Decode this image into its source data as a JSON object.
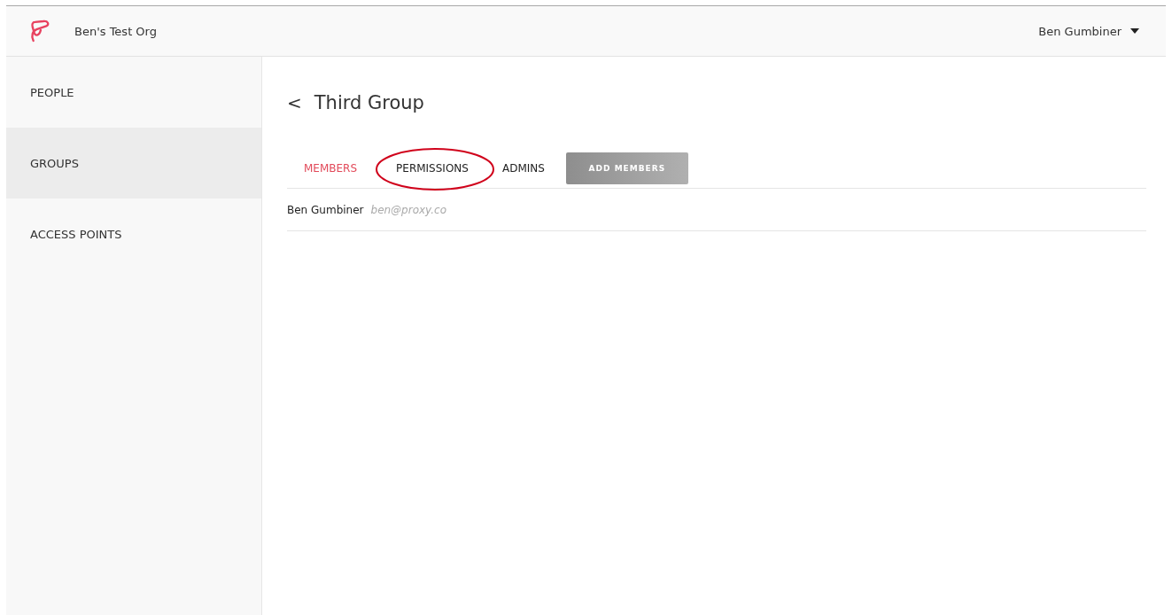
{
  "header": {
    "org_name": "Ben's Test Org",
    "user_menu": "Ben Gumbiner"
  },
  "sidebar": {
    "items": [
      {
        "label": "PEOPLE",
        "selected": false
      },
      {
        "label": "GROUPS",
        "selected": true
      },
      {
        "label": "ACCESS POINTS",
        "selected": false
      }
    ]
  },
  "page": {
    "back": "<",
    "title": "Third Group"
  },
  "tabs": [
    {
      "label": "MEMBERS",
      "selected": true,
      "circled": false
    },
    {
      "label": "PERMISSIONS",
      "selected": false,
      "circled": true
    },
    {
      "label": "ADMINS",
      "selected": false,
      "circled": false
    }
  ],
  "add_button": {
    "label": "ADD MEMBERS",
    "disabled": true
  },
  "members": [
    {
      "name": "Ben Gumbiner",
      "email": "ben@proxy.co"
    }
  ]
}
